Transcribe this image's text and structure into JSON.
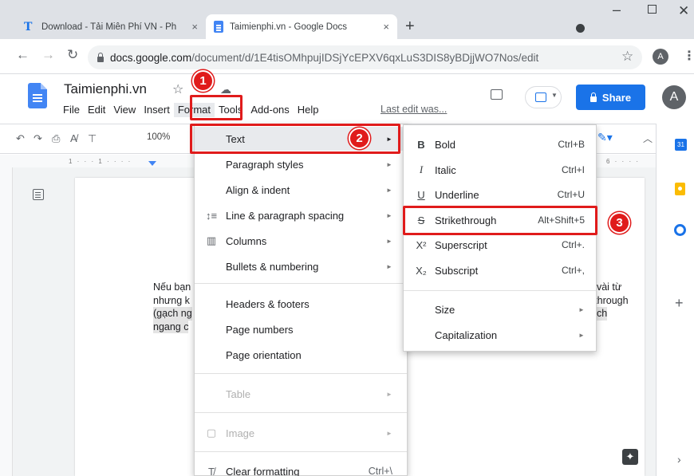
{
  "browser": {
    "tabs": [
      {
        "title": "Download - Tải Miễn Phí VN - Ph"
      },
      {
        "title": "Taimienphi.vn - Google Docs"
      }
    ],
    "tab_close": "×",
    "new_tab": "+",
    "url_host": "docs.google.com",
    "url_path": "/document/d/1E4tisOMhpujIDSjYcEPXV6qxLuS3DIS8yBDjjWO7Nos/edit",
    "profile_initial": "A"
  },
  "docs": {
    "title": "Taimienphi.vn",
    "menu": [
      "File",
      "Edit",
      "View",
      "Insert",
      "Format",
      "Tools",
      "Add-ons",
      "Help"
    ],
    "last_edit": "Last edit was...",
    "share_label": "Share",
    "avatar_initial": "A",
    "zoom": "100%",
    "ruler_marks": "1 · · · 1 · · · ·",
    "ruler_right": "6 · · · ·",
    "doc_left_lines": [
      "Nếu bạn",
      "nhưng k",
      "(gạch ng",
      "ngang c"
    ],
    "doc_right_lines": [
      "t vài từ",
      "-through",
      "ạch"
    ],
    "calendar_badge": "31"
  },
  "format_menu": {
    "items": [
      {
        "label": "Text",
        "icon": "",
        "arrow": "►"
      },
      {
        "label": "Paragraph styles",
        "icon": "",
        "arrow": "►"
      },
      {
        "label": "Align & indent",
        "icon": "",
        "arrow": "►"
      },
      {
        "label": "Line & paragraph spacing",
        "icon": "↕≡",
        "arrow": "►"
      },
      {
        "label": "Columns",
        "icon": "▥",
        "arrow": "►"
      },
      {
        "label": "Bullets & numbering",
        "icon": "",
        "arrow": "►"
      },
      {
        "label": "Headers & footers",
        "icon": ""
      },
      {
        "label": "Page numbers",
        "icon": ""
      },
      {
        "label": "Page orientation",
        "icon": ""
      },
      {
        "label": "Table",
        "icon": "",
        "arrow": "►",
        "disabled": true
      },
      {
        "label": "Image",
        "icon": "▢",
        "arrow": "►",
        "disabled": true
      },
      {
        "label": "Clear formatting",
        "icon": "T̸",
        "shortcut": "Ctrl+\\"
      }
    ]
  },
  "text_submenu": {
    "items": [
      {
        "icon": "B",
        "label": "Bold",
        "shortcut": "Ctrl+B"
      },
      {
        "icon": "I",
        "label": "Italic",
        "shortcut": "Ctrl+I"
      },
      {
        "icon": "U",
        "label": "Underline",
        "shortcut": "Ctrl+U"
      },
      {
        "icon": "S",
        "label": "Strikethrough",
        "shortcut": "Alt+Shift+5"
      },
      {
        "icon": "X²",
        "label": "Superscript",
        "shortcut": "Ctrl+."
      },
      {
        "icon": "X₂",
        "label": "Subscript",
        "shortcut": "Ctrl+,"
      },
      {
        "icon": "",
        "label": "Size",
        "arrow": "►"
      },
      {
        "icon": "",
        "label": "Capitalization",
        "arrow": "►"
      }
    ]
  },
  "annotations": {
    "steps": [
      "1",
      "2",
      "3"
    ],
    "color": "#e01b1b"
  },
  "colors": {
    "accent": "#1a73e8",
    "chrome": "#dee1e6"
  }
}
